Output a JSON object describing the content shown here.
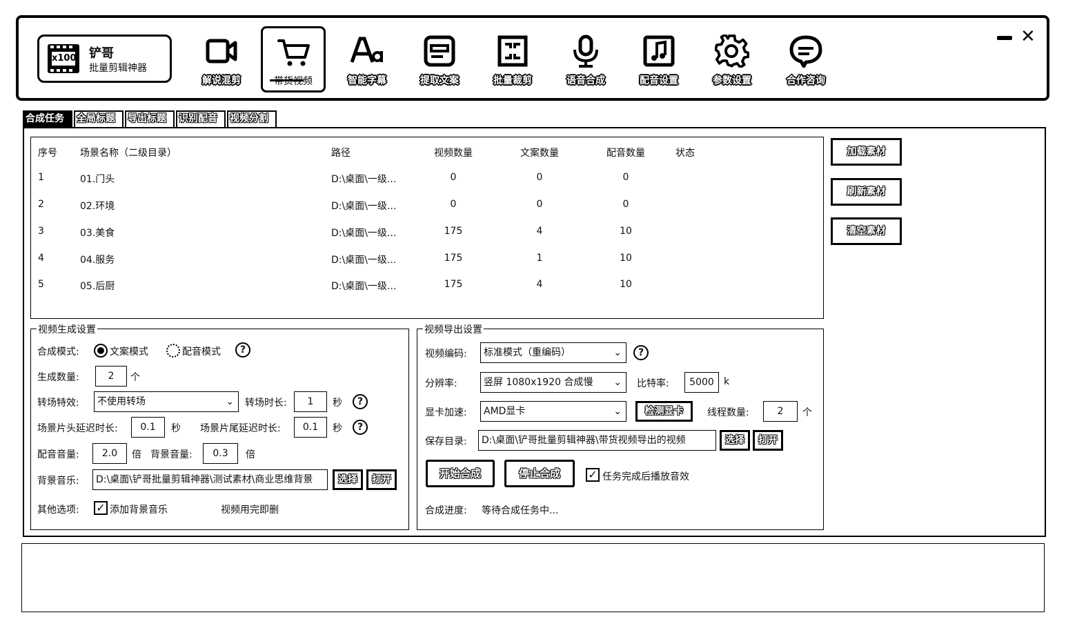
{
  "app": {
    "logo_badge": "x100",
    "name": "铲哥",
    "subtitle": "批量剪辑神器"
  },
  "nav": [
    {
      "label": "解说混剪",
      "icon": "video-camera-icon"
    },
    {
      "label": "带货视频",
      "icon": "shopping-cart-icon",
      "active": true
    },
    {
      "label": "智能字幕",
      "icon": "font-icon"
    },
    {
      "label": "提取文案",
      "icon": "document-icon"
    },
    {
      "label": "批量裁剪",
      "icon": "crop-icon"
    },
    {
      "label": "语音合成",
      "icon": "microphone-icon"
    },
    {
      "label": "配音设置",
      "icon": "music-note-icon"
    },
    {
      "label": "参数设置",
      "icon": "gear-icon"
    },
    {
      "label": "合作咨询",
      "icon": "chat-icon"
    }
  ],
  "window": {
    "minimize": "—",
    "close": "✕"
  },
  "tabs": [
    {
      "label": "合成任务",
      "active": true
    },
    {
      "label": "全局标题"
    },
    {
      "label": "导出标题"
    },
    {
      "label": "识别配音"
    },
    {
      "label": "视频分割"
    }
  ],
  "table": {
    "headers": [
      "序号",
      "场景名称（二级目录）",
      "路径",
      "视频数量",
      "文案数量",
      "配音数量",
      "状态"
    ],
    "rows": [
      [
        "1",
        "01.门头",
        "D:\\桌面\\一级...",
        "0",
        "0",
        "0",
        ""
      ],
      [
        "2",
        "02.环境",
        "D:\\桌面\\一级...",
        "0",
        "0",
        "0",
        ""
      ],
      [
        "3",
        "03.美食",
        "D:\\桌面\\一级...",
        "175",
        "4",
        "10",
        ""
      ],
      [
        "4",
        "04.服务",
        "D:\\桌面\\一级...",
        "175",
        "1",
        "10",
        ""
      ],
      [
        "5",
        "05.后厨",
        "D:\\桌面\\一级...",
        "175",
        "4",
        "10",
        ""
      ]
    ]
  },
  "side_buttons": {
    "load": "加载素材",
    "refresh": "刷新素材",
    "clear": "清空素材"
  },
  "gen": {
    "title": "视频生成设置",
    "mode_label": "合成模式:",
    "mode_text": "文案模式",
    "mode_voice": "配音模式",
    "count_label": "生成数量:",
    "count_value": "2",
    "count_unit": "个",
    "trans_label": "转场特效:",
    "trans_value": "不使用转场",
    "trans_dur_label": "转场时长:",
    "trans_dur_value": "1",
    "sec": "秒",
    "head_delay_label": "场景片头延迟时长:",
    "head_delay_value": "0.1",
    "tail_delay_label": "场景片尾延迟时长:",
    "tail_delay_value": "0.1",
    "voice_vol_label": "配音音量:",
    "voice_vol_value": "2.0",
    "times": "倍",
    "bg_vol_label": "背景音量:",
    "bg_vol_value": "0.3",
    "bgm_label": "背景音乐:",
    "bgm_value": "D:\\桌面\\铲哥批量剪辑神器\\测试素材\\商业思维背景",
    "choose": "选择",
    "open": "打开",
    "other_label": "其他选项:",
    "add_bgm": "添加背景音乐",
    "delete_after": "视频用完即删"
  },
  "export": {
    "title": "视频导出设置",
    "codec_label": "视频编码:",
    "codec_value": "标准模式（重编码）",
    "res_label": "分辨率:",
    "res_value": "竖屏 1080x1920 合成慢",
    "bitrate_label": "比特率:",
    "bitrate_value": "5000",
    "bitrate_unit": "k",
    "gpu_label": "显卡加速:",
    "gpu_value": "AMD显卡",
    "detect_gpu": "检测显卡",
    "threads_label": "线程数量:",
    "threads_value": "2",
    "threads_unit": "个",
    "save_label": "保存目录:",
    "save_value": "D:\\桌面\\铲哥批量剪辑神器\\带货视频导出的视频",
    "choose": "选择",
    "open": "打开",
    "start": "开始合成",
    "stop": "停止合成",
    "play_sound": "任务完成后播放音效",
    "progress_label": "合成进度:",
    "progress_text": "等待合成任务中..."
  }
}
